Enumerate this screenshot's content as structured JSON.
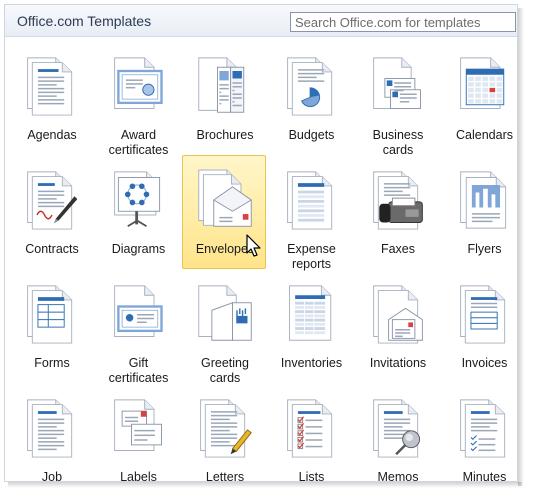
{
  "header": {
    "title": "Office.com Templates",
    "search_placeholder": "Search Office.com for templates"
  },
  "categories": [
    {
      "label": "Agendas",
      "icon": "agenda-icon"
    },
    {
      "label": "Award\ncertificates",
      "icon": "award-certificate-icon"
    },
    {
      "label": "Brochures",
      "icon": "brochure-icon"
    },
    {
      "label": "Budgets",
      "icon": "budget-icon"
    },
    {
      "label": "Business\ncards",
      "icon": "business-card-icon"
    },
    {
      "label": "Calendars",
      "icon": "calendar-icon"
    },
    {
      "label": "Contracts",
      "icon": "contract-icon"
    },
    {
      "label": "Diagrams",
      "icon": "diagram-icon"
    },
    {
      "label": "Envelopes",
      "icon": "envelope-icon",
      "selected": true
    },
    {
      "label": "Expense\nreports",
      "icon": "expense-report-icon"
    },
    {
      "label": "Faxes",
      "icon": "fax-icon"
    },
    {
      "label": "Flyers",
      "icon": "flyer-icon"
    },
    {
      "label": "Forms",
      "icon": "form-icon"
    },
    {
      "label": "Gift\ncertificates",
      "icon": "gift-certificate-icon"
    },
    {
      "label": "Greeting\ncards",
      "icon": "greeting-card-icon"
    },
    {
      "label": "Inventories",
      "icon": "inventory-icon"
    },
    {
      "label": "Invitations",
      "icon": "invitation-icon"
    },
    {
      "label": "Invoices",
      "icon": "invoice-icon"
    },
    {
      "label": "Job\ndescriptions",
      "icon": "job-description-icon"
    },
    {
      "label": "Labels",
      "icon": "label-icon"
    },
    {
      "label": "Letters",
      "icon": "letter-icon"
    },
    {
      "label": "Lists",
      "icon": "list-icon"
    },
    {
      "label": "Memos",
      "icon": "memo-icon"
    },
    {
      "label": "Minutes",
      "icon": "minutes-icon"
    }
  ],
  "colors": {
    "selected_fill": "#ffe48a",
    "selected_border": "#e8c44f",
    "icon_blue": "#2e6db4"
  }
}
